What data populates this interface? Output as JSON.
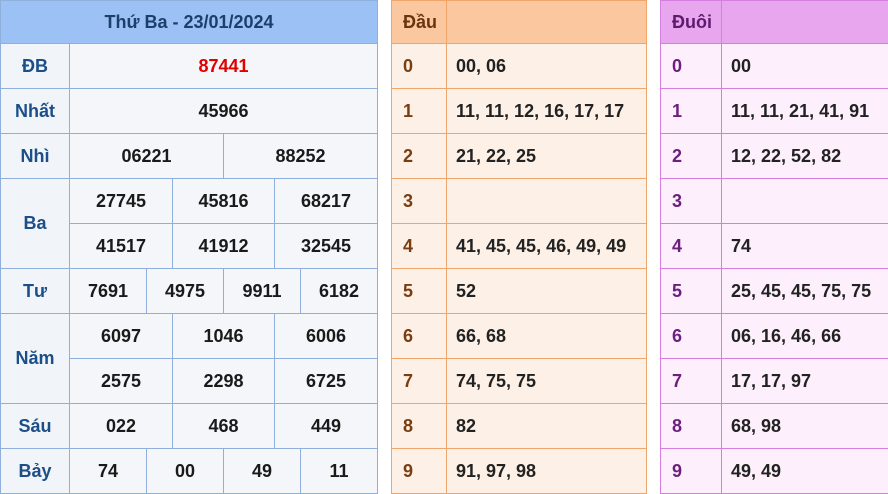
{
  "results": {
    "header": "Thứ Ba - 23/01/2024",
    "rows": [
      {
        "label": "ĐB",
        "values": [
          "87441"
        ]
      },
      {
        "label": "Nhất",
        "values": [
          "45966"
        ]
      },
      {
        "label": "Nhì",
        "values": [
          "06221",
          "88252"
        ]
      },
      {
        "label": "Ba",
        "values": [
          "27745",
          "45816",
          "68217",
          "41517",
          "41912",
          "32545"
        ]
      },
      {
        "label": "Tư",
        "values": [
          "7691",
          "4975",
          "9911",
          "6182"
        ]
      },
      {
        "label": "Năm",
        "values": [
          "6097",
          "1046",
          "6006",
          "2575",
          "2298",
          "6725"
        ]
      },
      {
        "label": "Sáu",
        "values": [
          "022",
          "468",
          "449"
        ]
      },
      {
        "label": "Bảy",
        "values": [
          "74",
          "00",
          "49",
          "11"
        ]
      }
    ],
    "special_color": "#e00000"
  },
  "dau": {
    "header": "Đầu",
    "rows": [
      {
        "digit": "0",
        "values": "00, 06"
      },
      {
        "digit": "1",
        "values": "11, 11, 12, 16, 17, 17"
      },
      {
        "digit": "2",
        "values": "21, 22, 25"
      },
      {
        "digit": "3",
        "values": ""
      },
      {
        "digit": "4",
        "values": "41, 45, 45, 46, 49, 49"
      },
      {
        "digit": "5",
        "values": "52"
      },
      {
        "digit": "6",
        "values": "66, 68"
      },
      {
        "digit": "7",
        "values": "74, 75, 75"
      },
      {
        "digit": "8",
        "values": "82"
      },
      {
        "digit": "9",
        "values": "91, 97, 98"
      }
    ]
  },
  "duoi": {
    "header": "Đuôi",
    "rows": [
      {
        "digit": "0",
        "values": "00"
      },
      {
        "digit": "1",
        "values": "11, 11, 21, 41, 91"
      },
      {
        "digit": "2",
        "values": "12, 22, 52, 82"
      },
      {
        "digit": "3",
        "values": ""
      },
      {
        "digit": "4",
        "values": "74"
      },
      {
        "digit": "5",
        "values": "25, 45, 45, 75, 75"
      },
      {
        "digit": "6",
        "values": "06, 16, 46, 66"
      },
      {
        "digit": "7",
        "values": "17, 17, 97"
      },
      {
        "digit": "8",
        "values": "68, 98"
      },
      {
        "digit": "9",
        "values": "49, 49"
      }
    ]
  }
}
